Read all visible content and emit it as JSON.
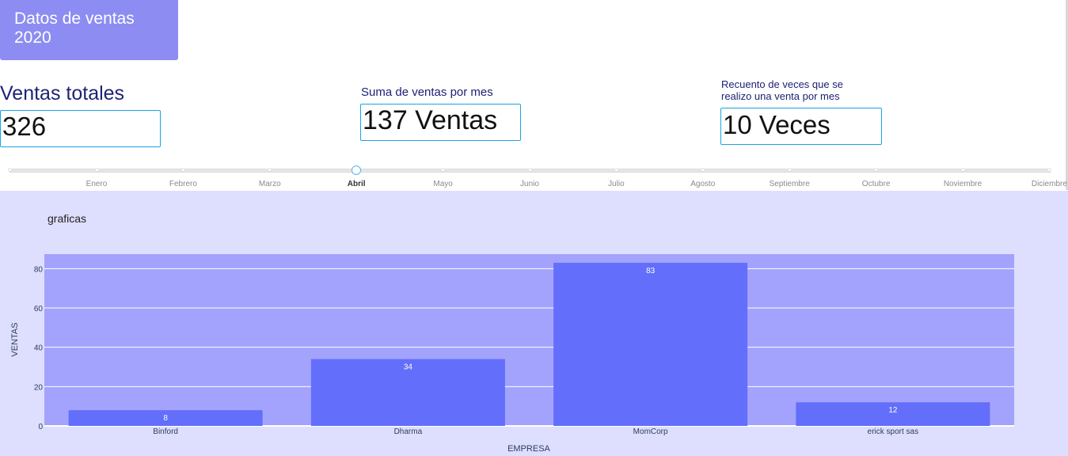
{
  "header": {
    "title": "Datos de ventas 2020"
  },
  "kpis": {
    "total": {
      "label": "Ventas totales",
      "value": "326"
    },
    "monthly_sum": {
      "label": "Suma de ventas por mes",
      "value": "137 Ventas"
    },
    "count": {
      "label": "Recuento de veces que se realizo una venta por mes",
      "value": "10 Veces"
    }
  },
  "slider": {
    "months": [
      "Enero",
      "Febrero",
      "Marzo",
      "Abril",
      "Mayo",
      "Junio",
      "Julio",
      "Agosto",
      "Septiembre",
      "Octubre",
      "Noviembre",
      "Diciembre"
    ],
    "selected": "Abril"
  },
  "colors": {
    "bar": "#636efa",
    "plot_bg": "#a3a3fd",
    "panel_bg": "#dedefe",
    "slider_accent": "#53b7e8"
  },
  "chart_title": "graficas",
  "chart_data": {
    "type": "bar",
    "categories": [
      "Binford",
      "Dharma",
      "MomCorp",
      "erick sport sas"
    ],
    "values": [
      8,
      34,
      83,
      12
    ],
    "xlabel": "EMPRESA",
    "ylabel": "VENTAS",
    "ylim": [
      0,
      87.4
    ],
    "yticks": [
      0,
      20,
      40,
      60,
      80
    ],
    "grid": true
  }
}
